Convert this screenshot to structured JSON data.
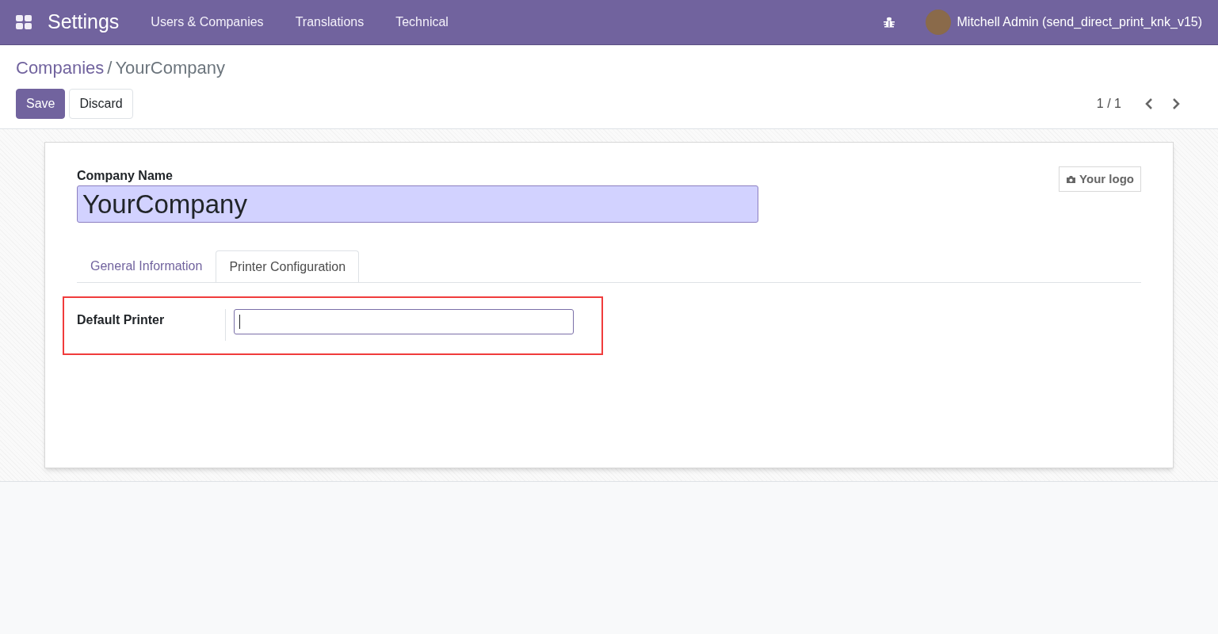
{
  "navbar": {
    "app_title": "Settings",
    "menu": [
      {
        "label": "Users & Companies"
      },
      {
        "label": "Translations"
      },
      {
        "label": "Technical"
      }
    ],
    "user": "Mitchell Admin (send_direct_print_knk_v15)"
  },
  "breadcrumb": [
    {
      "label": "Companies",
      "kind": "link"
    },
    {
      "label": "/",
      "kind": "separator"
    },
    {
      "label": "YourCompany",
      "kind": "current"
    }
  ],
  "buttons": [
    {
      "label": "Save",
      "kind": "primary"
    },
    {
      "label": "Discard",
      "kind": "secondary"
    }
  ],
  "pager": "1 / 1",
  "form": {
    "name_label": "Company Name",
    "name_value": "YourCompany",
    "logo_button": "Your logo",
    "tabs": [
      {
        "label": "General Information",
        "selected": false
      },
      {
        "label": "Printer Configuration",
        "selected": true
      }
    ],
    "fields": [
      {
        "label": "Default Printer",
        "focused": true,
        "highlighted": true
      }
    ]
  }
}
